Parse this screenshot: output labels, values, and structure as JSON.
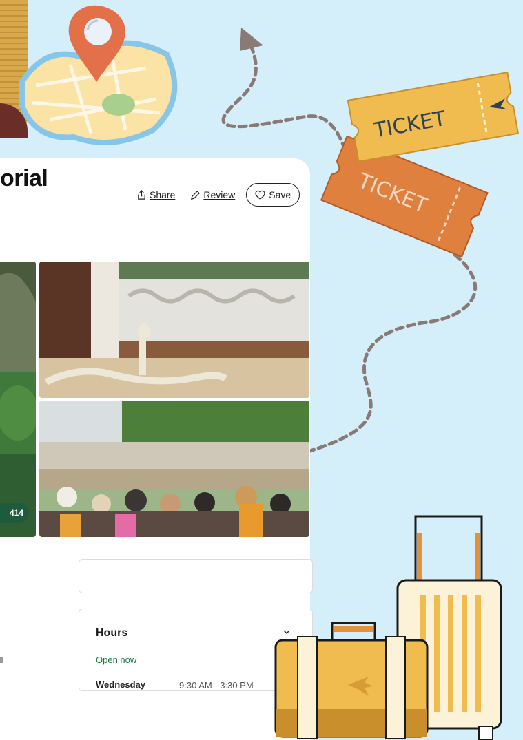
{
  "header": {
    "title_fragment": "orial",
    "share_label": "Share",
    "review_label": "Review",
    "save_label": "Save"
  },
  "gallery": {
    "photo_count": "414"
  },
  "hours": {
    "title": "Hours",
    "status": "Open now",
    "day": "Wednesday",
    "time": "9:30 AM - 3:30 PM"
  },
  "stickers": {
    "ticket_front": "TICKET",
    "ticket_back": "TICKET"
  },
  "colors": {
    "background": "#d4eefa",
    "accent_green": "#1e5b3d",
    "open_green": "#1e7a43",
    "ticket_yellow": "#f0bc4f",
    "ticket_orange": "#e0803f",
    "pin_red": "#e4704a"
  }
}
